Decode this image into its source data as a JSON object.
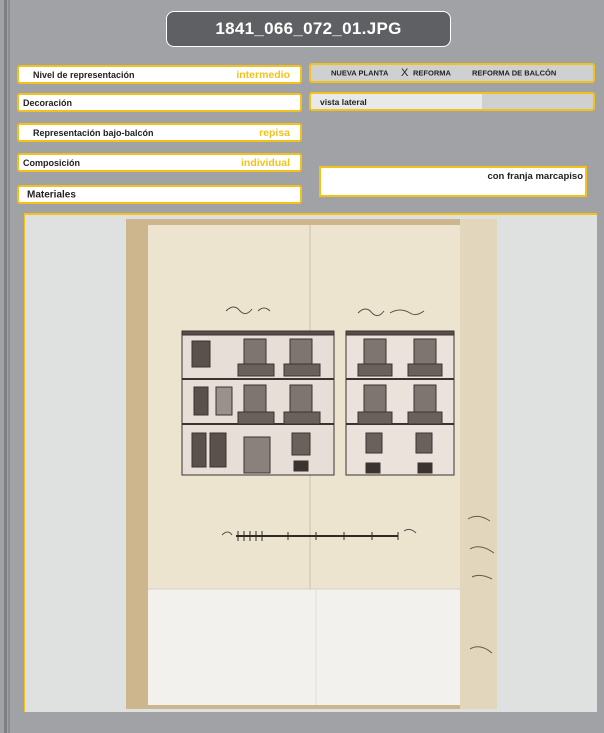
{
  "title": "1841_066_072_01.JPG",
  "fields": {
    "nivel": {
      "label": "Nivel de representación",
      "value": "intermedio"
    },
    "decoracion": {
      "label": "Decoración",
      "value": ""
    },
    "representacion": {
      "label": "Representación bajo-balcón",
      "value": "repisa"
    },
    "composicion": {
      "label": "Composición",
      "value": "individual"
    },
    "materiales": {
      "label": "Materiales",
      "value": ""
    }
  },
  "options": {
    "nueva_planta": "NUEVA PLANTA",
    "selected_mark": "X",
    "reforma": "REFORMA",
    "reforma_balcon": "REFORMA DE  BALCÓN"
  },
  "vista": {
    "label": "vista lateral"
  },
  "franja": {
    "label": "con franja marcapiso"
  },
  "colors": {
    "accent": "#f2c21a",
    "panel": "#a0a2a5",
    "title_bg": "#5f6063"
  }
}
